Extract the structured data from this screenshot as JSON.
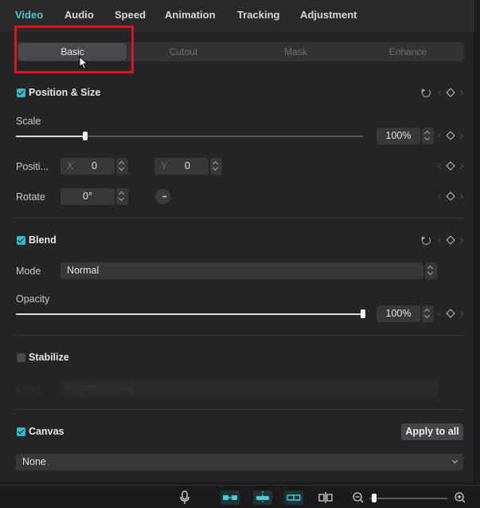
{
  "top_tabs": [
    "Video",
    "Audio",
    "Speed",
    "Animation",
    "Tracking",
    "Adjustment"
  ],
  "sub_tabs": [
    "Basic",
    "Cutout",
    "Mask",
    "Enhance"
  ],
  "position_size": {
    "title": "Position & Size",
    "scale_label": "Scale",
    "scale_value": "100%",
    "scale_fraction": 0.2,
    "position_label": "Positi...",
    "x_label": "X",
    "x_value": "0",
    "y_label": "Y",
    "y_value": "0",
    "rotate_label": "Rotate",
    "rotate_value": "0°"
  },
  "blend": {
    "title": "Blend",
    "mode_label": "Mode",
    "mode_value": "Normal",
    "opacity_label": "Opacity",
    "opacity_value": "100%",
    "opacity_fraction": 1.0
  },
  "stabilize": {
    "title": "Stabilize",
    "level_label": "Level",
    "level_value": "Recommended"
  },
  "canvas": {
    "title": "Canvas",
    "apply_label": "Apply to all",
    "value": "None"
  },
  "colors": {
    "accent": "#4cc9d4",
    "checkbox": "#35b9c4",
    "highlight_box": "#e0141c"
  },
  "bottom_icons": [
    "microphone-icon",
    "link-clips-icon",
    "auto-snap-icon",
    "preview-axis-icon",
    "split-icon",
    "zoom-out-icon",
    "zoom-slider",
    "zoom-in-icon"
  ]
}
